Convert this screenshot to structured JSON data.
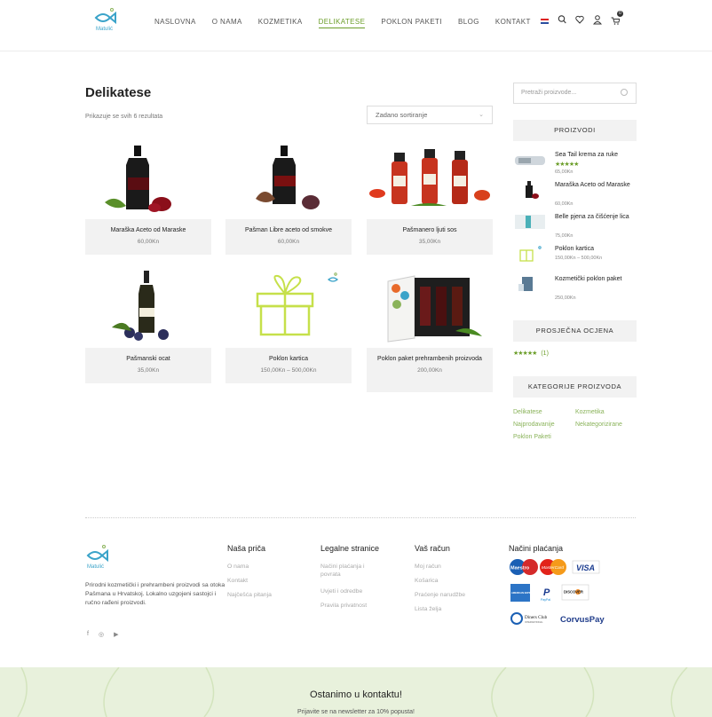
{
  "header": {
    "logo_text": "Matulić",
    "nav": [
      "NASLOVNA",
      "O NAMA",
      "KOZMETIKA",
      "DELIKATESE",
      "POKLON PAKETI",
      "BLOG",
      "KONTAKT"
    ],
    "active_nav": "DELIKATESE",
    "cart_count": "0"
  },
  "main": {
    "title": "Delikatese",
    "result_count": "Prikazuje se svih 6 rezultata",
    "sort_label": "Zadano sortiranje",
    "products": [
      {
        "name": "Maraška Aceto od Maraske",
        "price": "60,00Kn"
      },
      {
        "name": "Pašman Libre aceto od smokve",
        "price": "60,00Kn"
      },
      {
        "name": "Pašmanero ljuti sos",
        "price": "35,00Kn"
      },
      {
        "name": "Pašmanski ocat",
        "price": "35,00Kn"
      },
      {
        "name": "Poklon kartica",
        "price": "150,00Kn – 500,00Kn"
      },
      {
        "name": "Poklon paket prehrambenih proizvoda",
        "price": "200,00Kn"
      }
    ]
  },
  "sidebar": {
    "search_placeholder": "Pretraži proizvode...",
    "products_title": "PROIZVODI",
    "products": [
      {
        "name": "Sea Tail krema za ruke",
        "price": "65,00Kn",
        "stars": "★★★★★"
      },
      {
        "name": "Maraška Aceto od Maraske",
        "price": "60,00Kn"
      },
      {
        "name": "Belle pjena za čišćenje lica",
        "price": "75,00Kn"
      },
      {
        "name": "Poklon kartica",
        "price": "150,00Kn – 500,00Kn"
      },
      {
        "name": "Kozmetički poklon paket",
        "price": "250,00Kn"
      }
    ],
    "rating_title": "PROSJEČNA OCJENA",
    "rating_stars": "★★★★★",
    "rating_count": "(1)",
    "categories_title": "KATEGORIJE PROIZVODA",
    "categories": [
      "Delikatese",
      "Kozmetika",
      "Najprodavanije",
      "Nekategorizirane",
      "Poklon Paketi"
    ]
  },
  "footer": {
    "logo_text": "Matulić",
    "about": "Prirodni kozmetički i prehrambeni proizvodi sa otoka Pašmana u Hrvatskoj. Lokalno uzgojeni sastojci i ručno rađeni proizvodi.",
    "social": [
      "f",
      "◎",
      "▶"
    ],
    "col1_title": "Naša priča",
    "col1_links": [
      "O nama",
      "Kontakt",
      "Najčešća pitanja"
    ],
    "col2_title": "Legalne stranice",
    "col2_links": [
      "Načini plaćanja i povrata",
      "Uvjeti i odredbe",
      "Pravila privatnost"
    ],
    "col3_title": "Vaš račun",
    "col3_links": [
      "Moj račun",
      "Košarica",
      "Praćenje narudžbe",
      "Lista želja"
    ],
    "col4_title": "Načini plaćanja",
    "payments": [
      "Maestro",
      "MasterCard",
      "VISA",
      "AMERICAN EXPRESS",
      "PayPal",
      "DISCOVER",
      "Diners Club",
      "CorvusPay"
    ]
  },
  "newsletter": {
    "title": "Ostanimo u kontaktu!",
    "subtitle": "Prijavite se na newsletter za 10% popusta!"
  },
  "colors": {
    "accent": "#6c9e2a",
    "newsletter_bg": "#e8f1dc"
  }
}
